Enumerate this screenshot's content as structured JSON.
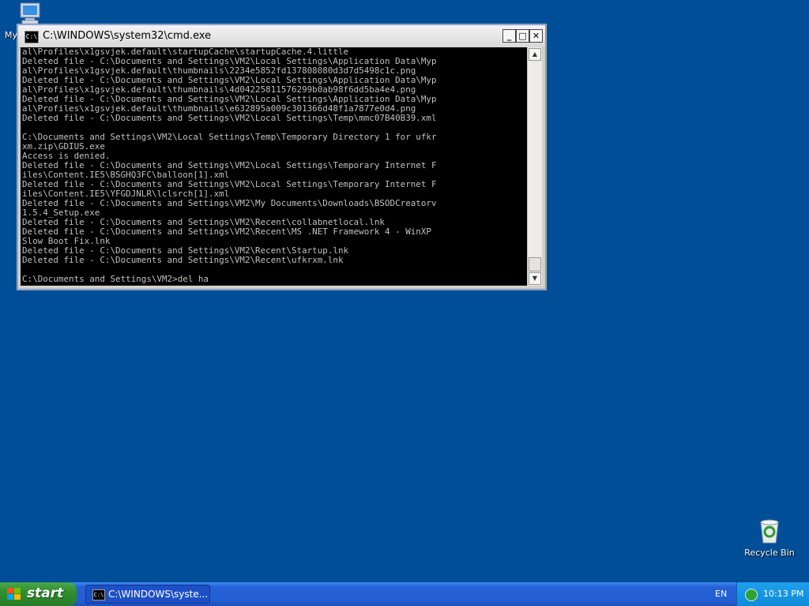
{
  "desktop": {
    "my_computer_label": "My",
    "recycle_bin_label": "Recycle Bin"
  },
  "window": {
    "title": "C:\\WINDOWS\\system32\\cmd.exe",
    "icon_text": "C:\\",
    "minimize_glyph": "_",
    "maximize_glyph": "□",
    "close_glyph": "✕",
    "console_lines": [
      "al\\Profiles\\x1gsvjek.default\\startupCache\\startupCache.4.little",
      "Deleted file - C:\\Documents and Settings\\VM2\\Local Settings\\Application Data\\Myp",
      "al\\Profiles\\x1gsvjek.default\\thumbnails\\2234e5852fd137808080d3d7d5498c1c.png",
      "Deleted file - C:\\Documents and Settings\\VM2\\Local Settings\\Application Data\\Myp",
      "al\\Profiles\\x1gsvjek.default\\thumbnails\\4d04225811576299b0ab98f6dd5ba4e4.png",
      "Deleted file - C:\\Documents and Settings\\VM2\\Local Settings\\Application Data\\Myp",
      "al\\Profiles\\x1gsvjek.default\\thumbnails\\e632895a009c301366d48f1a7877e0d4.png",
      "Deleted file - C:\\Documents and Settings\\VM2\\Local Settings\\Temp\\mmc07B40B39.xml",
      "",
      "C:\\Documents and Settings\\VM2\\Local Settings\\Temp\\Temporary Directory 1 for ufkr",
      "xm.zip\\GDIUS.exe",
      "Access is denied.",
      "Deleted file - C:\\Documents and Settings\\VM2\\Local Settings\\Temporary Internet F",
      "iles\\Content.IE5\\BSGHQ3FC\\balloon[1].xml",
      "Deleted file - C:\\Documents and Settings\\VM2\\Local Settings\\Temporary Internet F",
      "iles\\Content.IE5\\YFGDJNLR\\lclsrch[1].xml",
      "Deleted file - C:\\Documents and Settings\\VM2\\My Documents\\Downloads\\BSODCreatorv",
      "1.5.4_Setup.exe",
      "Deleted file - C:\\Documents and Settings\\VM2\\Recent\\collabnetlocal.lnk",
      "Deleted file - C:\\Documents and Settings\\VM2\\Recent\\MS .NET Framework 4 - WinXP",
      "Slow Boot Fix.lnk",
      "Deleted file - C:\\Documents and Settings\\VM2\\Recent\\Startup.lnk",
      "Deleted file - C:\\Documents and Settings\\VM2\\Recent\\ufkrxm.lnk",
      "",
      "C:\\Documents and Settings\\VM2>del ha"
    ]
  },
  "taskbar": {
    "start_label": "start",
    "task_label": "C:\\WINDOWS\\syste...",
    "language": "EN",
    "clock": "10:13 PM"
  }
}
